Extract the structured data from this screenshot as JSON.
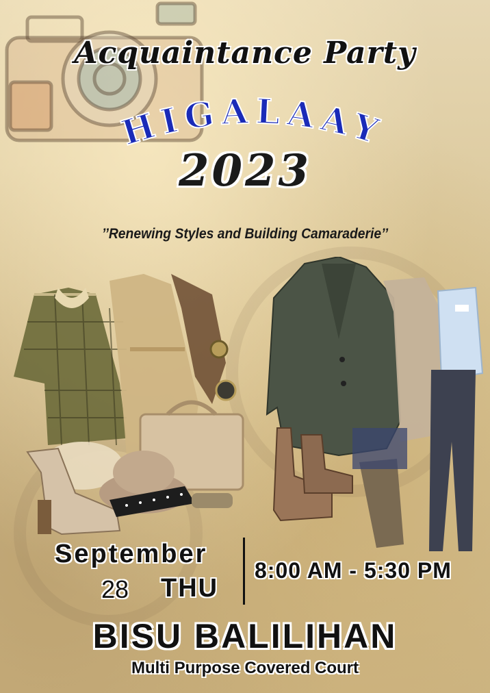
{
  "poster": {
    "event_type": "Acquaintance Party",
    "event_name": "HIGALAAY",
    "year": "2023",
    "tagline": "’’Renewing Styles and Building Camaraderie’’",
    "date": {
      "month": "September",
      "day": "28",
      "weekday": "THU"
    },
    "time": "8:00 AM - 5:30 PM",
    "venue": "BISU BALILIHAN",
    "venue_detail": "Multi Purpose Covered Court"
  },
  "colors": {
    "title_blue": "#1a2bb8",
    "text_dark": "#111111",
    "background": "#d9c9a3"
  }
}
